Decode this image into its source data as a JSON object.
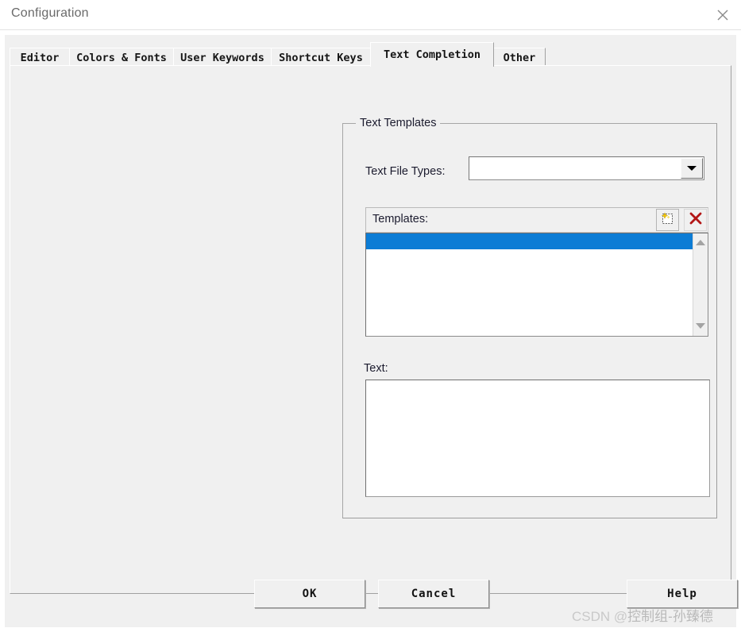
{
  "window": {
    "title": "Configuration",
    "close_icon": "close-icon"
  },
  "tabs": [
    {
      "label": "Editor",
      "active": false
    },
    {
      "label": "Colors & Fonts",
      "active": false
    },
    {
      "label": "User Keywords",
      "active": false
    },
    {
      "label": "Shortcut Keys",
      "active": false
    },
    {
      "label": "Text Completion",
      "active": true
    },
    {
      "label": "Other",
      "active": false
    }
  ],
  "group": {
    "title": "Text Templates"
  },
  "file_types": {
    "label": "Text File Types:",
    "value": "",
    "placeholder": "",
    "dropdown_icon": "chevron-down-icon"
  },
  "templates": {
    "label": "Templates:",
    "new_icon": "new-template-icon",
    "delete_icon": "delete-template-icon",
    "items": [
      ""
    ],
    "selected_index": 0,
    "scroll_up_icon": "scroll-up-icon",
    "scroll_down_icon": "scroll-down-icon"
  },
  "text_field": {
    "label": "Text:",
    "value": "",
    "placeholder": ""
  },
  "buttons": {
    "ok": "OK",
    "cancel": "Cancel",
    "help": "Help"
  },
  "watermark": {
    "prefix": "CSDN @",
    "author": "控制组-孙臻德"
  },
  "colors": {
    "selection_blue": "#0c7cd5",
    "panel_bg": "#f0f0f0",
    "titlebar_bg": "#ffffff",
    "delete_red": "#b31616",
    "title_text": "#6a6a6a"
  }
}
